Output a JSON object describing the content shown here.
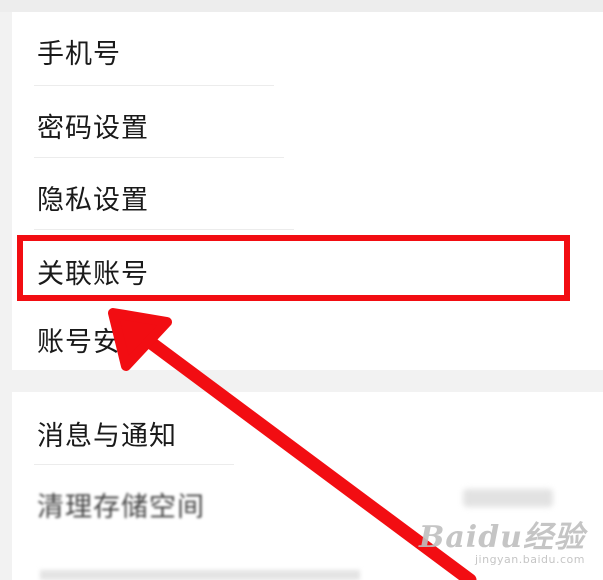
{
  "settings": {
    "items": [
      {
        "label": "手机号"
      },
      {
        "label": "密码设置"
      },
      {
        "label": "隐私设置"
      },
      {
        "label": "关联账号"
      },
      {
        "label": "账号安"
      },
      {
        "label": "消息与通知"
      },
      {
        "label": "清理存储空间"
      }
    ]
  },
  "annotation": {
    "highlight_color": "#f20d12",
    "highlighted_item": "关联账号"
  },
  "watermark": {
    "logo": "Baidu经验",
    "sub": "jingyan.baidu.com"
  }
}
